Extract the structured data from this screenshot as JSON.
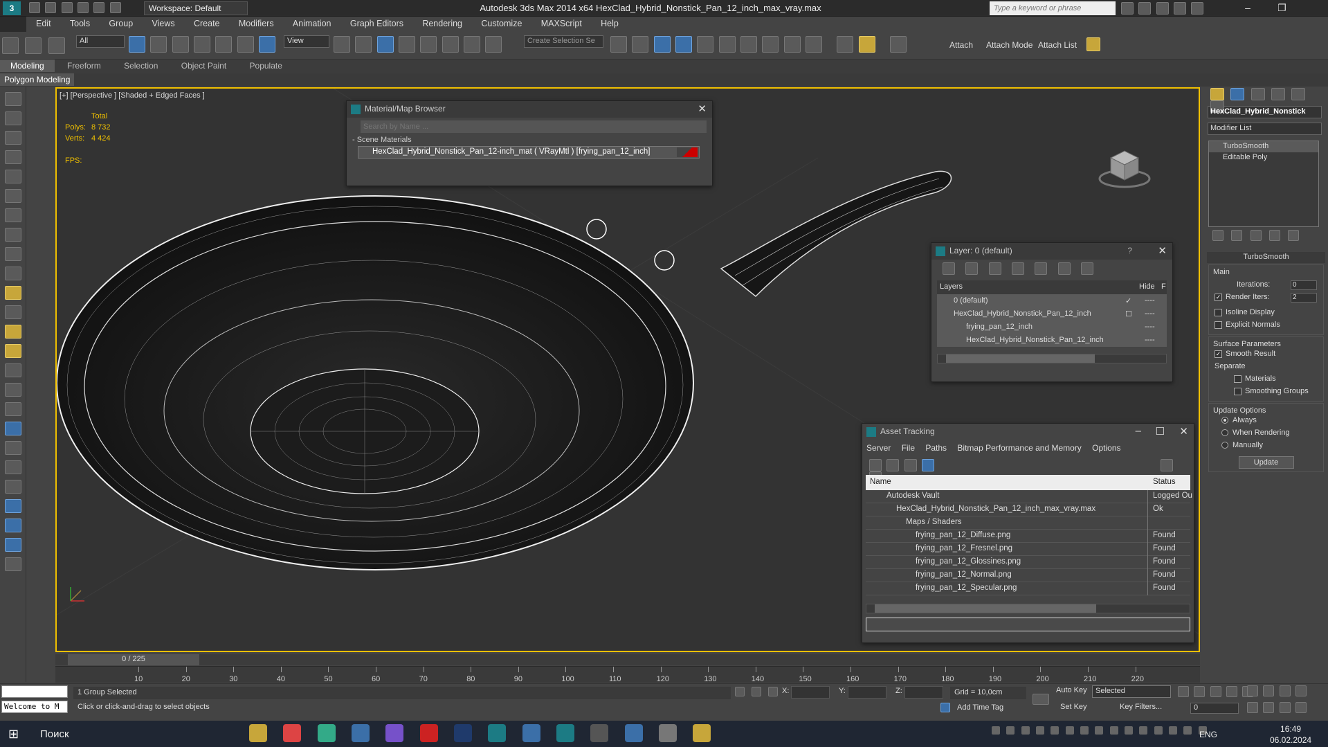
{
  "app": {
    "logo": "3",
    "workspace": "Workspace: Default",
    "title": "Autodesk 3ds Max  2014 x64      HexClad_Hybrid_Nonstick_Pan_12_inch_max_vray.max",
    "search_placeholder": "Type a keyword or phrase",
    "win_buttons": [
      "–",
      "❐",
      "✕"
    ]
  },
  "menu": [
    "Edit",
    "Tools",
    "Group",
    "Views",
    "Create",
    "Modifiers",
    "Animation",
    "Graph Editors",
    "Rendering",
    "Customize",
    "MAXScript",
    "Help"
  ],
  "toolbar": {
    "selection_filter": "All",
    "ref_coord": "View",
    "selection_set": "Create Selection Se",
    "attach": "Attach",
    "attach_mode": "Attach Mode",
    "attach_list": "Attach List"
  },
  "ribbon": {
    "tabs": [
      "Modeling",
      "Freeform",
      "Selection",
      "Object Paint",
      "Populate"
    ],
    "sub": "Polygon Modeling"
  },
  "viewport": {
    "label": "[+] [Perspective ] [Shaded + Edged Faces ]",
    "total_label": "Total",
    "polys_label": "Polys:",
    "polys": "8 732",
    "verts_label": "Verts:",
    "verts": "4 424",
    "fps_label": "FPS:"
  },
  "material_browser": {
    "title": "Material/Map Browser",
    "search_placeholder": "Search by Name ...",
    "section": "- Scene Materials",
    "material": "HexClad_Hybrid_Nonstick_Pan_12-inch_mat  ( VRayMtl ) [frying_pan_12_inch]"
  },
  "layer_window": {
    "title": "Layer: 0 (default)",
    "help": "?",
    "col_layers": "Layers",
    "col_hide": "Hide",
    "col_f": "F",
    "rows": [
      {
        "name": "0 (default)",
        "check": "✓"
      },
      {
        "name": "HexClad_Hybrid_Nonstick_Pan_12_inch",
        "check": "☐"
      },
      {
        "name": "frying_pan_12_inch",
        "check": ""
      },
      {
        "name": "HexClad_Hybrid_Nonstick_Pan_12_inch",
        "check": ""
      }
    ],
    "dash": "----"
  },
  "asset_tracking": {
    "title": "Asset Tracking",
    "menu": [
      "Server",
      "File",
      "Paths",
      "Bitmap Performance and Memory",
      "Options"
    ],
    "col_name": "Name",
    "col_status": "Status",
    "rows": [
      {
        "name": "Autodesk Vault",
        "status": "Logged Ou"
      },
      {
        "name": "HexClad_Hybrid_Nonstick_Pan_12_inch_max_vray.max",
        "status": "Ok"
      },
      {
        "name": "Maps / Shaders",
        "status": ""
      },
      {
        "name": "frying_pan_12_Diffuse.png",
        "status": "Found"
      },
      {
        "name": "frying_pan_12_Fresnel.png",
        "status": "Found"
      },
      {
        "name": "frying_pan_12_Glossines.png",
        "status": "Found"
      },
      {
        "name": "frying_pan_12_Normal.png",
        "status": "Found"
      },
      {
        "name": "frying_pan_12_Specular.png",
        "status": "Found"
      }
    ]
  },
  "command_panel": {
    "object_name": "HexClad_Hybrid_Nonstick",
    "modifier_list": "Modifier List",
    "stack": [
      "TurboSmooth",
      "Editable Poly"
    ],
    "rollout_title": "TurboSmooth",
    "main_label": "Main",
    "iterations_label": "Iterations:",
    "iterations": "0",
    "render_iters_label": "Render Iters:",
    "render_iters": "2",
    "isoline": "Isoline Display",
    "explicit_normals": "Explicit Normals",
    "surface_params": "Surface Parameters",
    "smooth_result": "Smooth Result",
    "separate": "Separate",
    "materials": "Materials",
    "smoothing_groups": "Smoothing Groups",
    "update_options": "Update Options",
    "always": "Always",
    "when_rendering": "When Rendering",
    "manually": "Manually",
    "update_button": "Update"
  },
  "timeline": {
    "frame": "0 / 225",
    "ticks": [
      "10",
      "20",
      "30",
      "40",
      "50",
      "60",
      "70",
      "80",
      "90",
      "100",
      "110",
      "120",
      "130",
      "140",
      "150",
      "160",
      "170",
      "180",
      "190",
      "200",
      "210",
      "220"
    ]
  },
  "status": {
    "maxscript_text": "Welcome to M",
    "selection": "1 Group Selected",
    "prompt": "Click or click-and-drag to select objects",
    "x_label": "X:",
    "y_label": "Y:",
    "z_label": "Z:",
    "grid": "Grid = 10,0cm",
    "add_time_tag": "Add Time Tag",
    "auto_key": "Auto Key",
    "set_key": "Set Key",
    "selected": "Selected",
    "key_filters": "Key Filters...",
    "frame_value": "0"
  },
  "taskbar": {
    "search": "Поиск",
    "lang": "ENG",
    "time": "16:49",
    "date": "06.02.2024"
  }
}
